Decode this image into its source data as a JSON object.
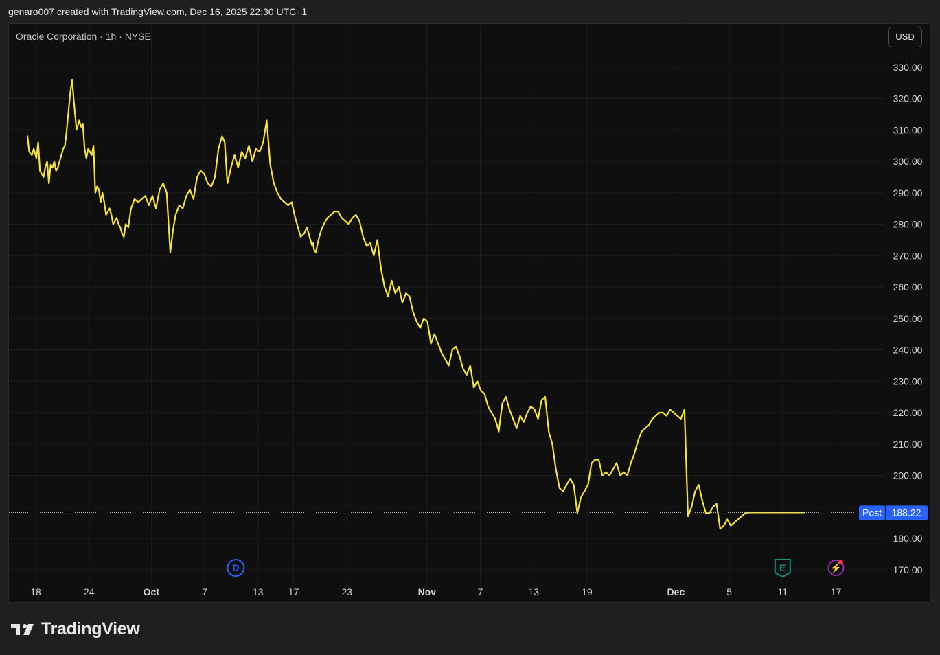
{
  "header": {
    "attribution": "genaro007 created with TradingView.com, Dec 16, 2025 22:30 UTC+1"
  },
  "chart_header": {
    "title": "Oracle Corporation · 1h · NYSE",
    "currency_button": "USD"
  },
  "footer": {
    "brand": "TradingView"
  },
  "colors": {
    "line": "#f7e43a",
    "background": "#0f0f0f",
    "post_label": "#2962ff",
    "grid": "#1c1c1c"
  },
  "chart_data": {
    "type": "line",
    "title": "Oracle Corporation · 1h · NYSE",
    "currency": "USD",
    "ylim": [
      165,
      340
    ],
    "y_ticks": [
      170,
      180,
      190,
      200,
      210,
      220,
      230,
      240,
      250,
      260,
      270,
      280,
      290,
      300,
      310,
      320,
      330
    ],
    "y_tick_labels": [
      "170.00",
      "180.00",
      "",
      "200.00",
      "210.00",
      "220.00",
      "230.00",
      "240.00",
      "250.00",
      "260.00",
      "270.00",
      "280.00",
      "290.00",
      "300.00",
      "310.00",
      "320.00",
      "330.00"
    ],
    "x_tick_labels": [
      "18",
      "24",
      "Oct",
      "7",
      "13",
      "17",
      "23",
      "Nov",
      "7",
      "13",
      "19",
      "Dec",
      "5",
      "11",
      "17"
    ],
    "x_tick_days": [
      0,
      6,
      13,
      19,
      25,
      29,
      35,
      44,
      50,
      56,
      62,
      72,
      78,
      84,
      90
    ],
    "x_tick_month": [
      false,
      false,
      true,
      false,
      false,
      false,
      false,
      true,
      false,
      false,
      false,
      true,
      false,
      false,
      false
    ],
    "x_range_days": [
      -3.0,
      93.0
    ],
    "grid": true,
    "last_value": {
      "label": "Post",
      "value": 188.22,
      "value_text": "188.22"
    },
    "event_markers": [
      {
        "type": "dividend",
        "letter": "D",
        "day": 22.5,
        "color": "#2962ff"
      },
      {
        "type": "earnings",
        "letter": "E",
        "day": 84.0,
        "color": "#089981"
      },
      {
        "type": "event",
        "letter": "⚡",
        "day": 90.0,
        "color": "#9c27b0"
      }
    ],
    "series": [
      {
        "x_days": [
          -3.0,
          -2.8,
          -2.5,
          -2.3,
          -2.0,
          -1.8,
          -1.6,
          -1.4,
          -1.2,
          -1.0,
          -0.8,
          -0.6,
          -0.4,
          -0.2,
          0.0,
          0.2,
          0.4,
          0.6,
          0.8,
          1.0,
          1.2,
          1.4,
          1.6,
          1.8,
          2.0,
          2.2,
          2.5,
          2.8,
          3.0,
          3.2,
          3.4,
          3.6,
          3.8,
          4.0,
          4.2,
          4.4,
          4.6,
          4.8,
          5.0,
          5.2,
          5.4,
          5.6,
          5.8,
          6.0,
          6.2,
          6.4,
          6.6,
          6.8,
          7.0,
          7.2,
          7.4,
          7.6,
          7.8,
          8.0,
          8.3,
          8.6,
          9.0,
          9.4,
          9.8,
          10.2,
          10.6,
          11.0,
          11.4,
          11.8,
          12.2,
          12.6,
          13.0,
          13.3,
          13.6,
          14.0,
          14.4,
          14.8,
          15.2,
          15.6,
          16.0,
          16.4,
          16.8,
          17.2,
          17.6,
          18.0,
          18.4,
          18.8,
          19.1,
          19.4,
          19.8,
          20.2,
          20.6,
          21.0,
          21.4,
          21.8,
          22.2,
          22.6,
          23.0,
          23.4,
          23.8,
          24.2,
          24.6,
          25.0,
          25.4,
          25.8,
          26.2,
          26.6,
          27.0,
          27.3,
          27.6,
          28.0,
          28.3,
          28.6,
          28.9,
          29.0,
          29.1,
          29.3,
          29.6,
          29.9,
          30.2,
          30.6,
          31.0,
          31.4,
          31.8,
          32.2,
          32.6,
          33.0,
          33.4,
          33.8,
          34.2,
          34.6,
          35.0,
          35.4,
          35.8,
          36.2,
          36.6,
          37.0,
          37.4,
          37.8,
          38.2,
          38.6,
          39.0,
          39.4,
          39.8,
          40.2,
          40.6,
          41.0,
          41.4,
          41.8,
          42.2,
          42.6,
          43.0,
          43.4,
          43.8,
          44.2,
          44.6,
          45.0,
          45.4,
          45.8,
          46.2,
          46.6,
          47.0,
          47.4,
          47.8,
          48.2,
          48.6,
          49.0,
          49.4,
          49.8,
          50.2,
          50.6,
          51.0,
          51.4,
          51.8,
          52.2,
          52.6,
          53.0,
          53.4,
          53.8,
          54.2,
          54.6,
          55.0,
          55.4,
          55.8,
          56.2,
          56.6,
          57.0,
          57.4,
          57.8,
          58.2,
          58.6,
          59.0,
          59.4,
          59.8,
          60.2,
          60.6,
          61.0,
          61.4,
          61.8,
          62.2,
          62.6,
          63.0,
          63.4,
          63.8,
          64.2,
          64.6,
          65.0,
          65.4,
          65.8,
          66.2,
          66.6,
          67.0,
          67.4,
          67.8,
          68.2,
          68.6,
          69.0,
          69.4,
          69.8,
          70.2,
          70.6,
          71.0,
          71.4,
          71.8,
          72.2,
          72.6,
          73.0,
          73.4,
          73.8,
          74.2,
          74.6,
          75.0,
          75.4,
          75.8,
          76.2,
          76.6,
          77.0,
          77.4,
          77.8,
          78.2,
          78.6,
          79.0,
          79.4,
          79.8,
          80.2,
          80.6,
          81.0,
          81.4,
          81.8,
          82.2,
          82.6,
          83.0,
          83.4,
          83.8,
          83.9,
          84.0,
          84.2,
          84.5,
          84.8,
          85.1,
          85.4,
          85.7,
          86.0,
          86.3,
          86.6,
          86.9,
          87.2,
          87.5,
          87.8,
          88.1,
          88.4,
          88.7,
          89.0,
          89.3,
          89.6
        ],
        "y": [
          308,
          303,
          302,
          304,
          301,
          306,
          297,
          296,
          295,
          298,
          300,
          293,
          299,
          298,
          300,
          297,
          298,
          300,
          302,
          304,
          305,
          310,
          316,
          322,
          326,
          319,
          310,
          313,
          311,
          312,
          304,
          301,
          304,
          303,
          302,
          305,
          290,
          292,
          291,
          287,
          290,
          287,
          283,
          284,
          285,
          283,
          280,
          281,
          282,
          280,
          279,
          277,
          276,
          280,
          279,
          285,
          288,
          287,
          288,
          289,
          286,
          289,
          285,
          291,
          293,
          290,
          271,
          278,
          283,
          286,
          285,
          289,
          291,
          288,
          295,
          297,
          296,
          293,
          292,
          295,
          304,
          308,
          306,
          293,
          298,
          302,
          298,
          303,
          301,
          305,
          300,
          304,
          303,
          306,
          313,
          299,
          293,
          290,
          288,
          287,
          286,
          287,
          282,
          279,
          276,
          277,
          279,
          276,
          273,
          274,
          272,
          271,
          275,
          278,
          280,
          282,
          283,
          284,
          284,
          282,
          281,
          280,
          282,
          283,
          281,
          276,
          273,
          274,
          270,
          275,
          266,
          260,
          257,
          262,
          258,
          260,
          255,
          258,
          257,
          252,
          249,
          247,
          250,
          249,
          242,
          245,
          242,
          239,
          237,
          235,
          240,
          241,
          238,
          234,
          232,
          235,
          228,
          230,
          227,
          226,
          222,
          220,
          218,
          214,
          223,
          225,
          221,
          218,
          215,
          219,
          217,
          220,
          222,
          221,
          218,
          224,
          225,
          214,
          210,
          202,
          196,
          195,
          197,
          199,
          197,
          188,
          193,
          195,
          197,
          204,
          205,
          205,
          200,
          201,
          200,
          202,
          204,
          200,
          201,
          200,
          204,
          207,
          211,
          214,
          215,
          216,
          218,
          219,
          220,
          220,
          219,
          221,
          220,
          219,
          218,
          221,
          187,
          190,
          195,
          197,
          192,
          188,
          188,
          190,
          191,
          183,
          184,
          186,
          184,
          185,
          186,
          187,
          188,
          188.22,
          188.22,
          188.22,
          188.22,
          188.22,
          188.22,
          188.22,
          188.22,
          188.22,
          188.22,
          188.22,
          188.22,
          188.22,
          188.22,
          188.22,
          188.22,
          188.22,
          188.22
        ]
      }
    ]
  }
}
